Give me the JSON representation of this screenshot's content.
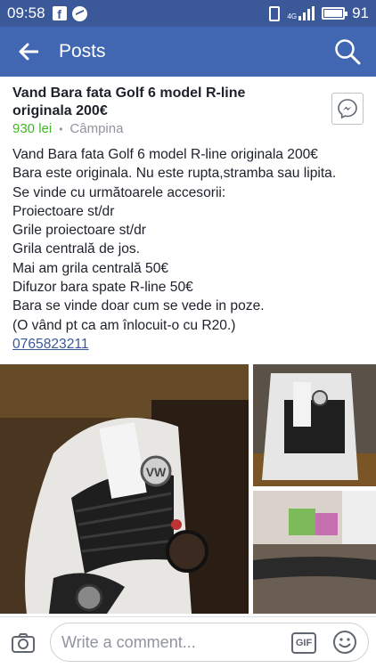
{
  "status_bar": {
    "time": "09:58",
    "network": "4G",
    "battery": "91"
  },
  "app_bar": {
    "title": "Posts"
  },
  "post": {
    "title": "Vand Bara fata Golf 6 model R-line originala 200€",
    "price": "930 lei",
    "separator": "•",
    "location": "Câmpina",
    "body_lines": [
      "Vand Bara fata Golf 6 model R-line originala 200€",
      "Bara este originala. Nu este rupta,stramba sau lipita.",
      "Se vinde cu următoarele accesorii:",
      "Proiectoare st/dr",
      "Grile proiectoare st/dr",
      "Grila centrală de jos.",
      "Mai am grila centrală 50€",
      "Difuzor bara spate R-line 50€",
      "Bara se vinde doar cum se vede in poze.",
      "(O vând pt ca am înlocuit-o cu R20.)"
    ],
    "phone": "0765823211",
    "photo_plate_text": "VW"
  },
  "comment_bar": {
    "placeholder": "Write a comment...",
    "gif_label": "GIF"
  },
  "colors": {
    "brand": "#4267b2",
    "status_bar": "#3b5998",
    "price": "#42b72a",
    "link": "#385898",
    "muted": "#90949c"
  }
}
